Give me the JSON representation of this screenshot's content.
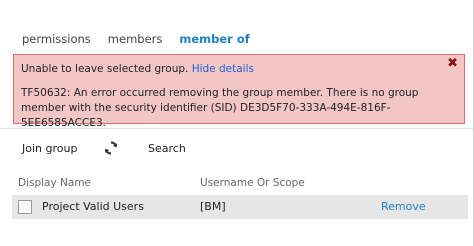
{
  "tabs": [
    {
      "label": "permissions"
    },
    {
      "label": "members"
    },
    {
      "label": "member of"
    }
  ],
  "error": {
    "message": "Unable to leave selected group.",
    "link": "Hide details",
    "close_label": "✖",
    "detail": "TF50632: An error occurred removing the group member. There is no group member with the security identifier (SID) DE3D5F70-333A-494E-816F-5EE6585ACCE3."
  },
  "toolbar": {
    "join_label": "Join group",
    "refresh_icon": "refresh-icon",
    "search_label": "Search"
  },
  "table": {
    "columns": [
      "Display Name",
      "Username Or Scope"
    ],
    "rows": [
      {
        "name": "Project Valid Users",
        "scope": "[BM]",
        "action": "Remove"
      }
    ]
  },
  "colors": {
    "accent": "#1f7fc4",
    "error_bg": "#f3c6c6",
    "error_border": "#d86f6f",
    "link": "#1f5fd6"
  }
}
